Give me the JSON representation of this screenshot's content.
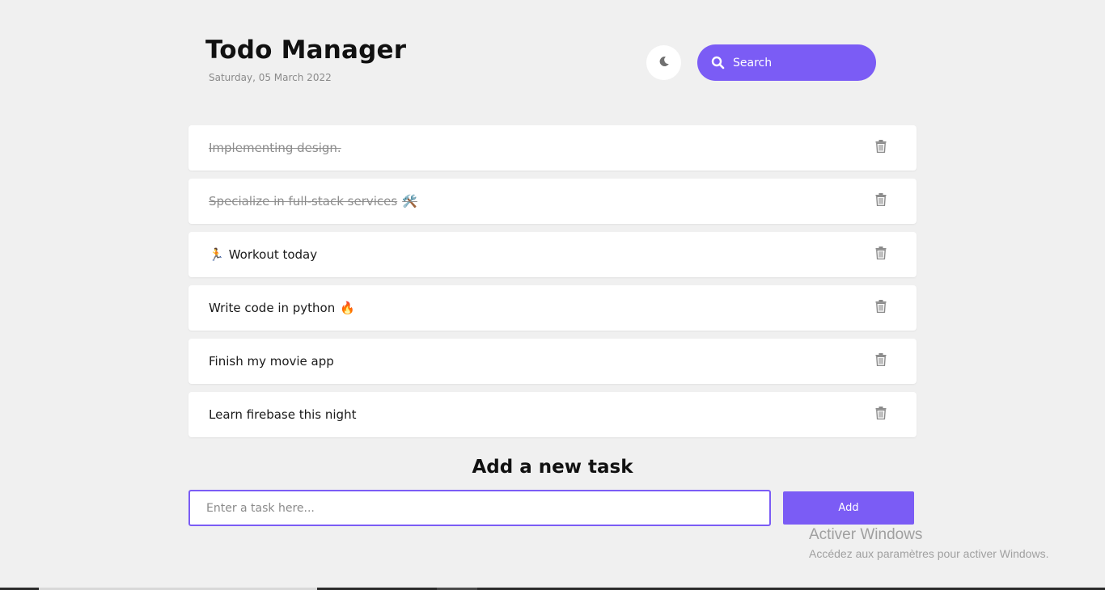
{
  "header": {
    "title": "Todo Manager",
    "date": "Saturday, 05 March 2022",
    "theme_toggle_icon": "moon-icon",
    "search": {
      "placeholder": "Search",
      "icon": "search-icon"
    }
  },
  "tasks": [
    {
      "text": "Implementing design.",
      "emoji": "",
      "emoji_position": "none",
      "completed": true
    },
    {
      "text": "Specialize in full-stack services",
      "emoji": "🛠️",
      "emoji_position": "after",
      "completed": true
    },
    {
      "text": "Workout today",
      "emoji": "🏃",
      "emoji_position": "before",
      "completed": false
    },
    {
      "text": "Write code in python",
      "emoji": "🔥",
      "emoji_position": "after",
      "completed": false
    },
    {
      "text": "Finish my movie app",
      "emoji": "",
      "emoji_position": "none",
      "completed": false
    },
    {
      "text": "Learn firebase this night",
      "emoji": "",
      "emoji_position": "none",
      "completed": false
    }
  ],
  "add_task": {
    "heading": "Add a new task",
    "input_placeholder": "Enter a task here...",
    "button_label": "Add"
  },
  "watermark": {
    "title": "Activer Windows",
    "subtitle": "Accédez aux paramètres pour activer Windows."
  },
  "colors": {
    "accent": "#7b5cf5",
    "background": "#f0f0f0",
    "card": "#ffffff",
    "done_text": "#8c8c8c"
  }
}
